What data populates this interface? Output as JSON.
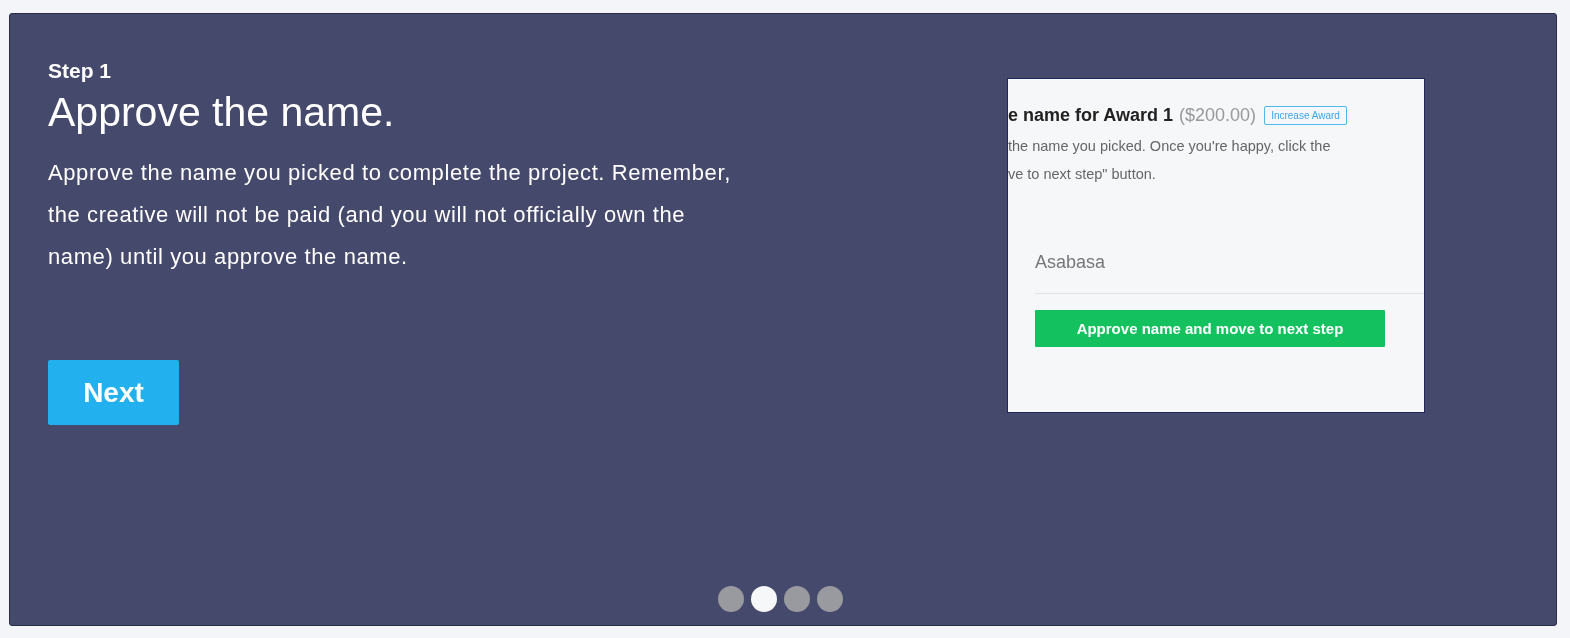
{
  "step_label": "Step 1",
  "title": "Approve the name.",
  "description": "Approve the name you picked to complete the project. Remember, the creative will not be paid (and you will not officially own the name) until you approve the name.",
  "next_button": "Next",
  "preview": {
    "heading": "e name for Award 1",
    "amount": "($200.00)",
    "increase_button": "Increase Award",
    "text_lines": [
      "the name you picked. Once you're happy, click the",
      "ve to next step\" button."
    ],
    "name": "Asabasa",
    "approve_button": "Approve name and move to next step"
  },
  "dots": [
    {
      "selected": false
    },
    {
      "selected": true
    },
    {
      "selected": false
    },
    {
      "selected": false
    }
  ]
}
